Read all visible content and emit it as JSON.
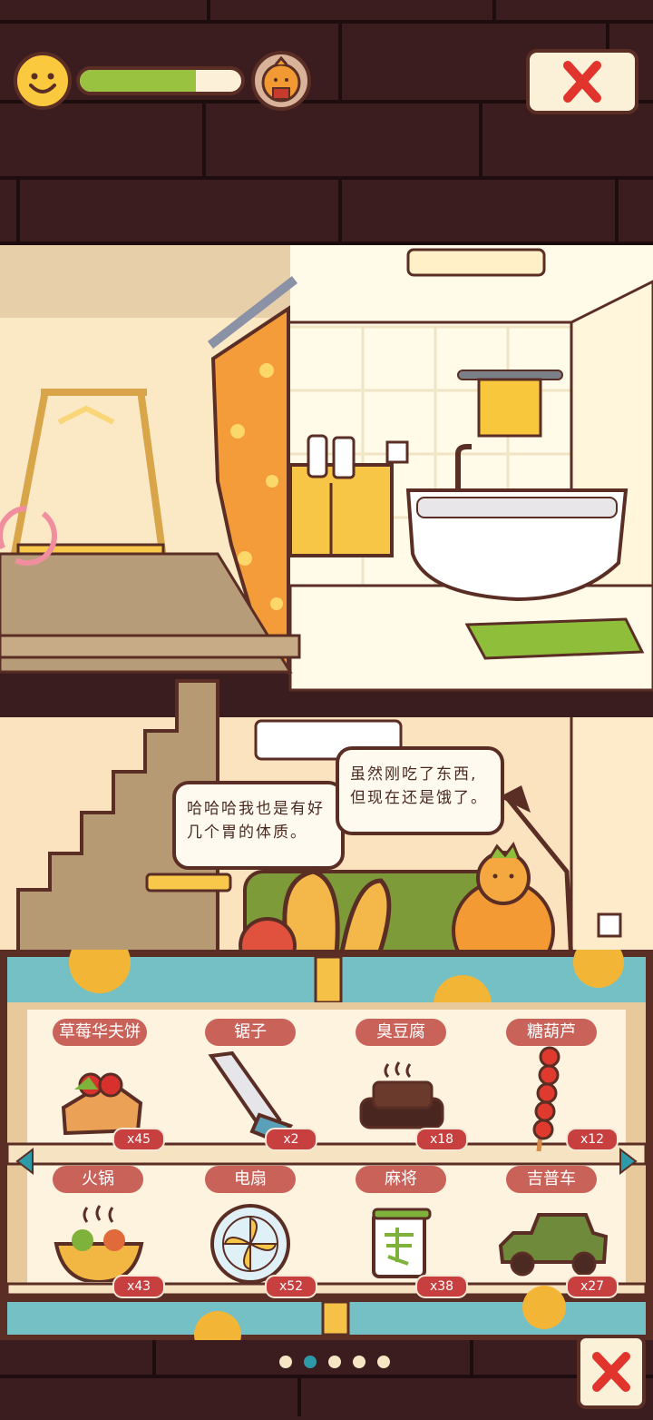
{
  "status": {
    "mood_icon": "smiley-face-icon",
    "hunger_level": 0.72,
    "avatar_icon": "orange-character-icon"
  },
  "buttons": {
    "close_icon": "close-x-icon"
  },
  "dialog": {
    "left_bubble": [
      "哈哈哈我也是有好",
      "几个胃的体质。"
    ],
    "right_bubble": [
      "虽然刚吃了东西,",
      "但现在还是饿了。"
    ]
  },
  "inventory": {
    "row1": [
      {
        "name": "草莓华夫饼",
        "count": "x45",
        "icon": "strawberry-waffle-icon"
      },
      {
        "name": "锯子",
        "count": "x2",
        "icon": "saw-icon"
      },
      {
        "name": "臭豆腐",
        "count": "x18",
        "icon": "stinky-tofu-icon"
      },
      {
        "name": "糖葫芦",
        "count": "x12",
        "icon": "candied-haws-icon"
      }
    ],
    "row2": [
      {
        "name": "火锅",
        "count": "x43",
        "icon": "hotpot-icon"
      },
      {
        "name": "电扇",
        "count": "x52",
        "icon": "electric-fan-icon"
      },
      {
        "name": "麻将",
        "count": "x38",
        "icon": "mahjong-icon"
      },
      {
        "name": "吉普车",
        "count": "x27",
        "icon": "jeep-icon"
      }
    ]
  },
  "pagination": {
    "total": 5,
    "active": 2
  },
  "colors": {
    "accent_green": "#98c23f",
    "tag_red": "#c9635a",
    "panel_teal": "#74c0c5",
    "outline_brown": "#5a2e24"
  }
}
